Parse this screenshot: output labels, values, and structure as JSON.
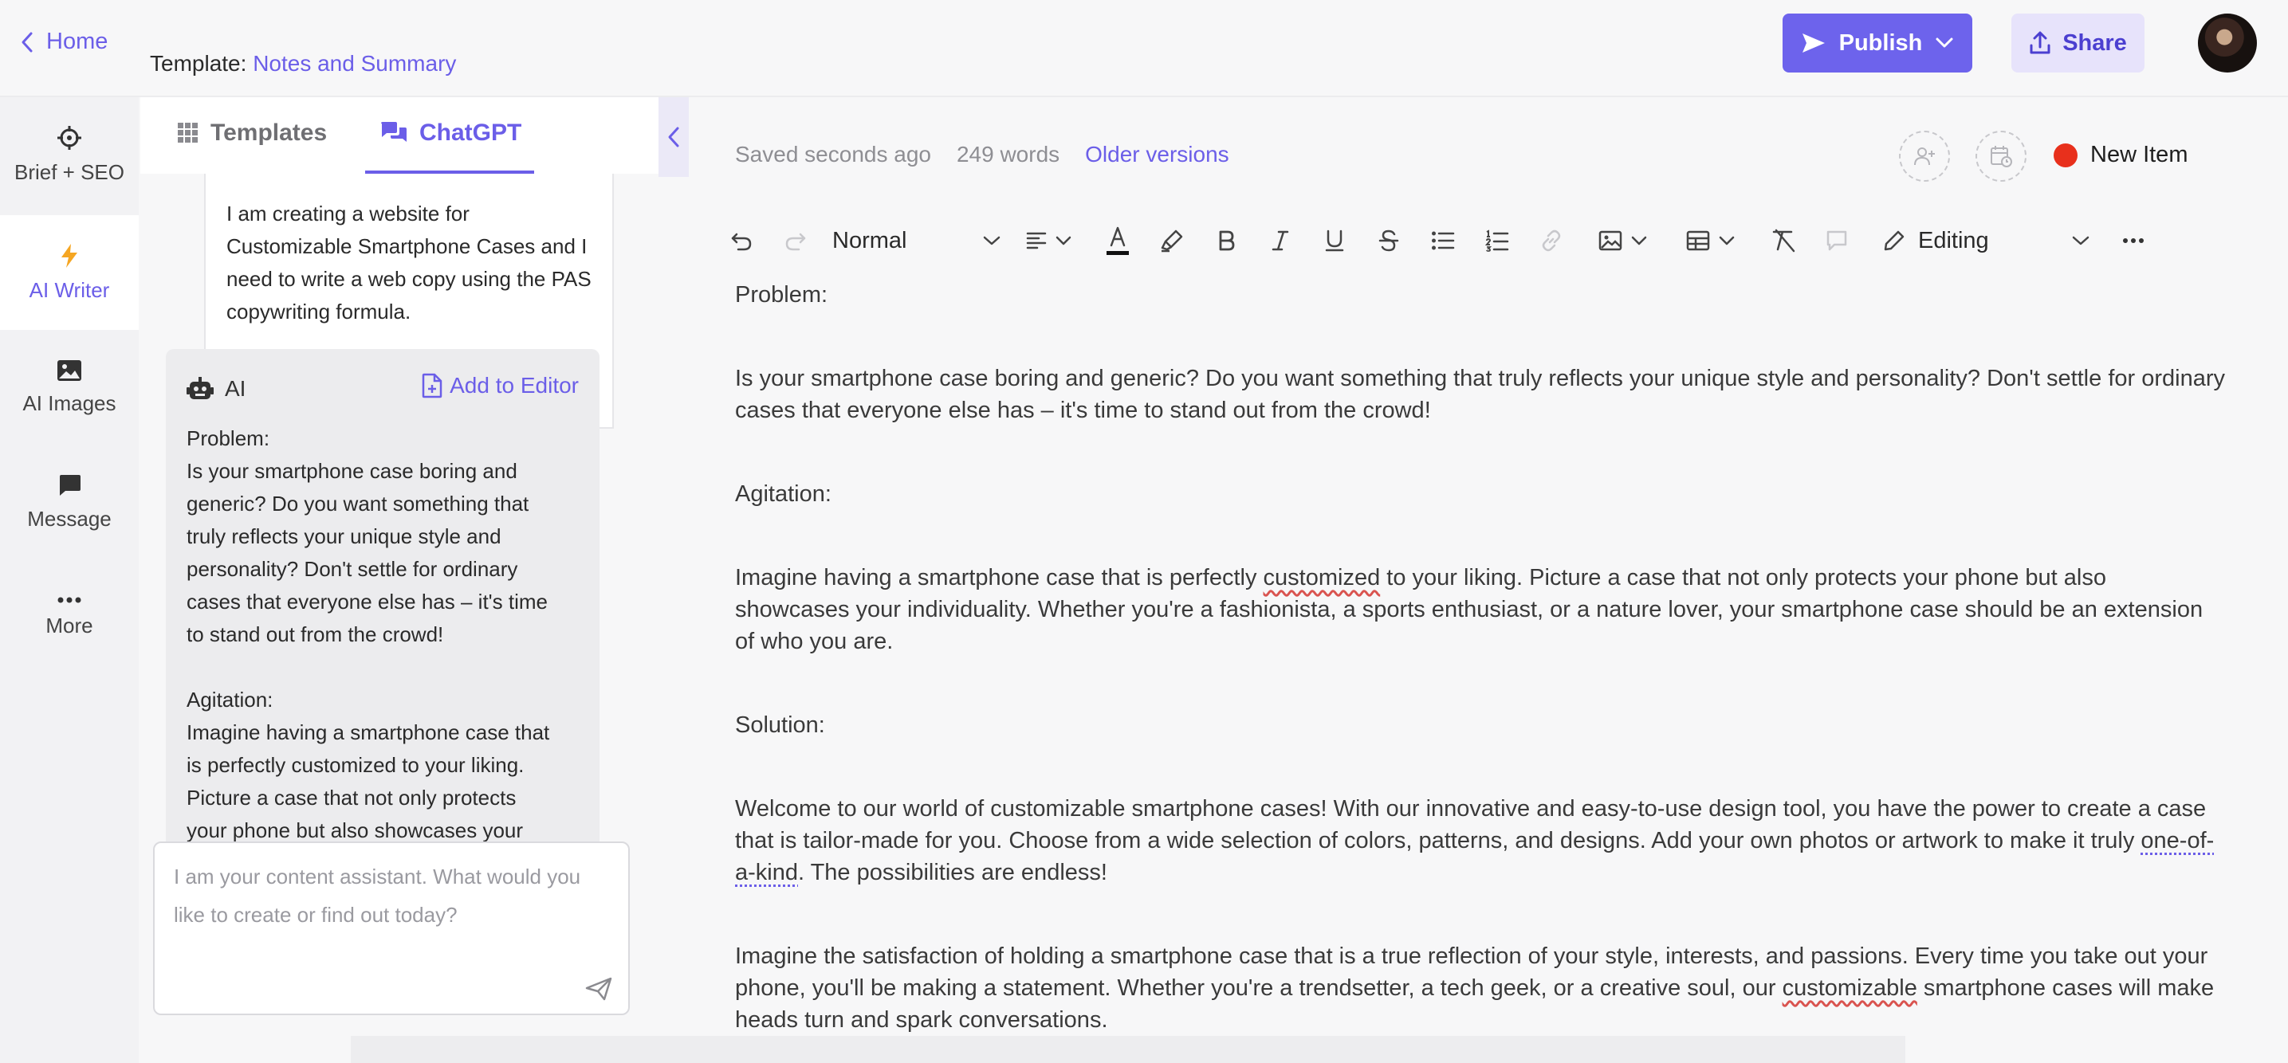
{
  "header": {
    "home_label": "Home",
    "template_prefix": "Template:",
    "template_name": "Notes and Summary",
    "publish_label": "Publish",
    "share_label": "Share"
  },
  "rail": {
    "items": [
      {
        "label": "Brief + SEO",
        "icon": "crosshair-icon"
      },
      {
        "label": "AI Writer",
        "icon": "lightning-icon"
      },
      {
        "label": "AI Images",
        "icon": "image-icon"
      },
      {
        "label": "Message",
        "icon": "message-icon"
      },
      {
        "label": "More",
        "icon": "ellipsis-icon"
      }
    ]
  },
  "chat": {
    "tabs": [
      {
        "label": "Templates",
        "icon": "grid-icon"
      },
      {
        "label": "ChatGPT",
        "icon": "chat-bubbles-icon"
      }
    ],
    "user_message": "I am creating a website for Customizable Smartphone Cases and I need to write a web copy using the PAS copywriting formula.",
    "ai_label": "AI",
    "add_to_editor": "Add to Editor",
    "ai_response": {
      "problem_heading": "Problem:",
      "problem_text": "Is your smartphone case boring and generic? Do you want something that truly reflects your unique style and personality? Don't settle for ordinary cases that everyone else has – it's time to stand out from the crowd!",
      "agitation_heading": "Agitation:",
      "agitation_text": "Imagine having a smartphone case that is perfectly customized to your liking. Picture a case that not only protects your phone but also showcases your"
    },
    "input_placeholder": "I am your content assistant. What would you like to create or find out today?"
  },
  "editor": {
    "saved_status": "Saved seconds ago",
    "word_count": "249 words",
    "older_versions": "Older versions",
    "item_status": "New Item",
    "status_color": "#e8301c",
    "toolbar": {
      "paragraph_style": "Normal",
      "mode": "Editing"
    },
    "content": {
      "problem_heading": "Problem:",
      "problem_text": "Is your smartphone case boring and generic? Do you want something that truly reflects your unique style and personality? Don't settle for ordinary cases that everyone else has – it's time to stand out from the crowd!",
      "agitation_heading": "Agitation:",
      "agitation_pre": "Imagine having a smartphone case that is perfectly ",
      "agitation_mark": "customized",
      "agitation_post": " to your liking. Picture a case that not only protects your phone but also showcases your individuality. Whether you're a fashionista, a sports enthusiast, or a nature lover, your smartphone case should be an extension of who you are.",
      "solution_heading": "Solution:",
      "solution_pre": "Welcome to our world of customizable smartphone cases! With our innovative and easy-to-use design tool, you have the power to create a case that is tailor-made for you. Choose from a wide selection of colors, patterns, and designs. Add your own photos or artwork to make it truly ",
      "solution_mark": "one-of-a-kind",
      "solution_post": ". The possibilities are endless!",
      "closing_pre": "Imagine the satisfaction of holding a smartphone case that is a true reflection of your style, interests, and passions. Every time you take out your phone, you'll be making a statement. Whether you're a trendsetter, a tech geek, or a creative soul, our ",
      "closing_mark": "customizable",
      "closing_post": " smartphone cases will make heads turn and spark conversations."
    }
  },
  "colors": {
    "accent": "#6b5ee8",
    "publish_bg": "#6d63ec",
    "share_bg": "#e7e3fb"
  }
}
